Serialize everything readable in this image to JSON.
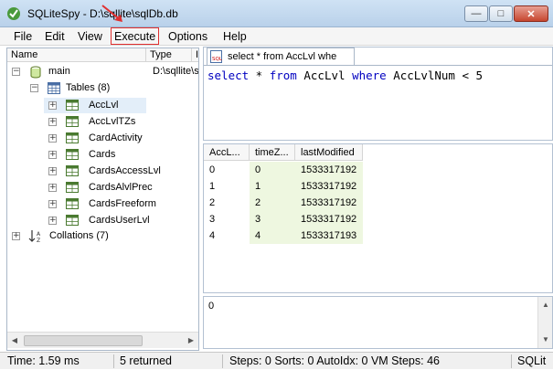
{
  "window": {
    "title": "SQLiteSpy - D:\\sqllite\\sqlDb.db",
    "minimize_glyph": "—",
    "maximize_glyph": "□",
    "close_glyph": "✕"
  },
  "menu": {
    "file": "File",
    "edit": "Edit",
    "view": "View",
    "execute": "Execute",
    "options": "Options",
    "help": "Help"
  },
  "highlight_color": "#e03030",
  "schema_tree": {
    "columns": [
      "Name",
      "Type",
      "I"
    ],
    "root": {
      "name": "main",
      "type": "D:\\sqllite\\s",
      "icon": "database-icon"
    },
    "tables_node": {
      "label": "Tables (8)",
      "icon": "tables-folder-icon"
    },
    "tables": [
      "AccLvl",
      "AccLvlTZs",
      "CardActivity",
      "Cards",
      "CardsAccessLvl",
      "CardsAlvlPrec",
      "CardsFreeform",
      "CardsUserLvl"
    ],
    "collations_node": {
      "label": "Collations (7)",
      "icon": "sort-az-icon"
    },
    "expanded_glyph": "−",
    "collapsed_glyph": "+"
  },
  "editor": {
    "tab_label": "select * from AccLvl whe",
    "sql": {
      "kw_select": "select",
      "star": " * ",
      "kw_from": "from",
      "table": " AccLvl ",
      "kw_where": "where",
      "rest": " AccLvlNum < 5"
    }
  },
  "results": {
    "columns": [
      "AccL...",
      "timeZ...",
      "lastModified"
    ],
    "rows": [
      [
        "0",
        "0",
        "1533317192"
      ],
      [
        "1",
        "1",
        "1533317192"
      ],
      [
        "2",
        "2",
        "1533317192"
      ],
      [
        "3",
        "3",
        "1533317192"
      ],
      [
        "4",
        "4",
        "1533317193"
      ]
    ]
  },
  "message": {
    "text": "0"
  },
  "statusbar": {
    "time": "Time: 1.59 ms",
    "returned": "5 returned",
    "steps": "Steps: 0  Sorts: 0 AutoIdx: 0 VM Steps: 46",
    "engine": "SQLit"
  }
}
